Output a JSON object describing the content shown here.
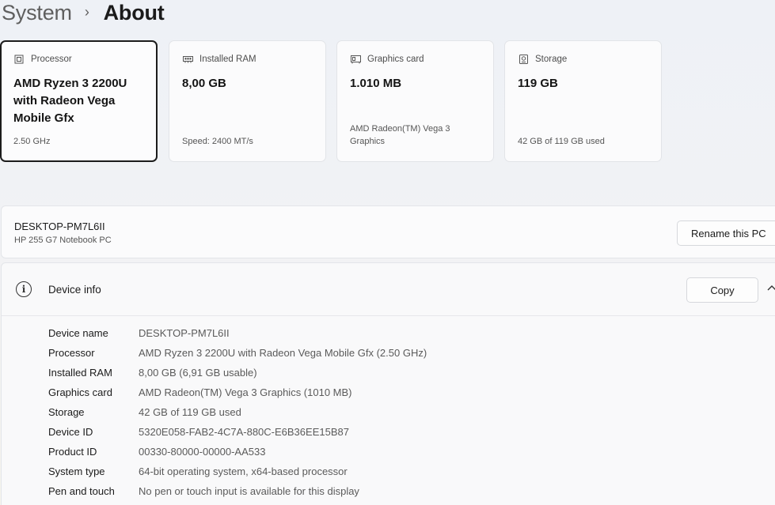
{
  "breadcrumb": {
    "parent": "System",
    "separator": "›",
    "current": "About"
  },
  "cards": [
    {
      "icon": "processor-icon",
      "title": "Processor",
      "value": "AMD Ryzen 3 2200U with Radeon Vega Mobile Gfx",
      "footer": "2.50 GHz",
      "selected": true
    },
    {
      "icon": "ram-icon",
      "title": "Installed RAM",
      "value": "8,00 GB",
      "footer": "Speed: 2400 MT/s",
      "selected": false
    },
    {
      "icon": "graphics-card-icon",
      "title": "Graphics card",
      "value": "1.010 MB",
      "footer": "AMD Radeon(TM) Vega 3 Graphics",
      "selected": false
    },
    {
      "icon": "storage-icon",
      "title": "Storage",
      "value": "119 GB",
      "footer": "42 GB of 119 GB used",
      "selected": false
    }
  ],
  "pc": {
    "name": "DESKTOP-PM7L6II",
    "model": "HP 255 G7 Notebook PC",
    "rename_label": "Rename this PC"
  },
  "device_info": {
    "title": "Device info",
    "copy_label": "Copy",
    "rows": [
      {
        "label": "Device name",
        "value": "DESKTOP-PM7L6II"
      },
      {
        "label": "Processor",
        "value": "AMD Ryzen 3 2200U with Radeon Vega Mobile Gfx (2.50 GHz)"
      },
      {
        "label": "Installed RAM",
        "value": "8,00 GB (6,91 GB usable)"
      },
      {
        "label": "Graphics card",
        "value": "AMD Radeon(TM) Vega 3 Graphics (1010 MB)"
      },
      {
        "label": "Storage",
        "value": "42 GB of 119 GB used"
      },
      {
        "label": "Device ID",
        "value": "5320E058-FAB2-4C7A-880C-E6B36EE15B87"
      },
      {
        "label": "Product ID",
        "value": "00330-80000-00000-AA533"
      },
      {
        "label": "System type",
        "value": "64-bit operating system, x64-based processor"
      },
      {
        "label": "Pen and touch",
        "value": "No pen or touch input is available for this display"
      }
    ]
  }
}
